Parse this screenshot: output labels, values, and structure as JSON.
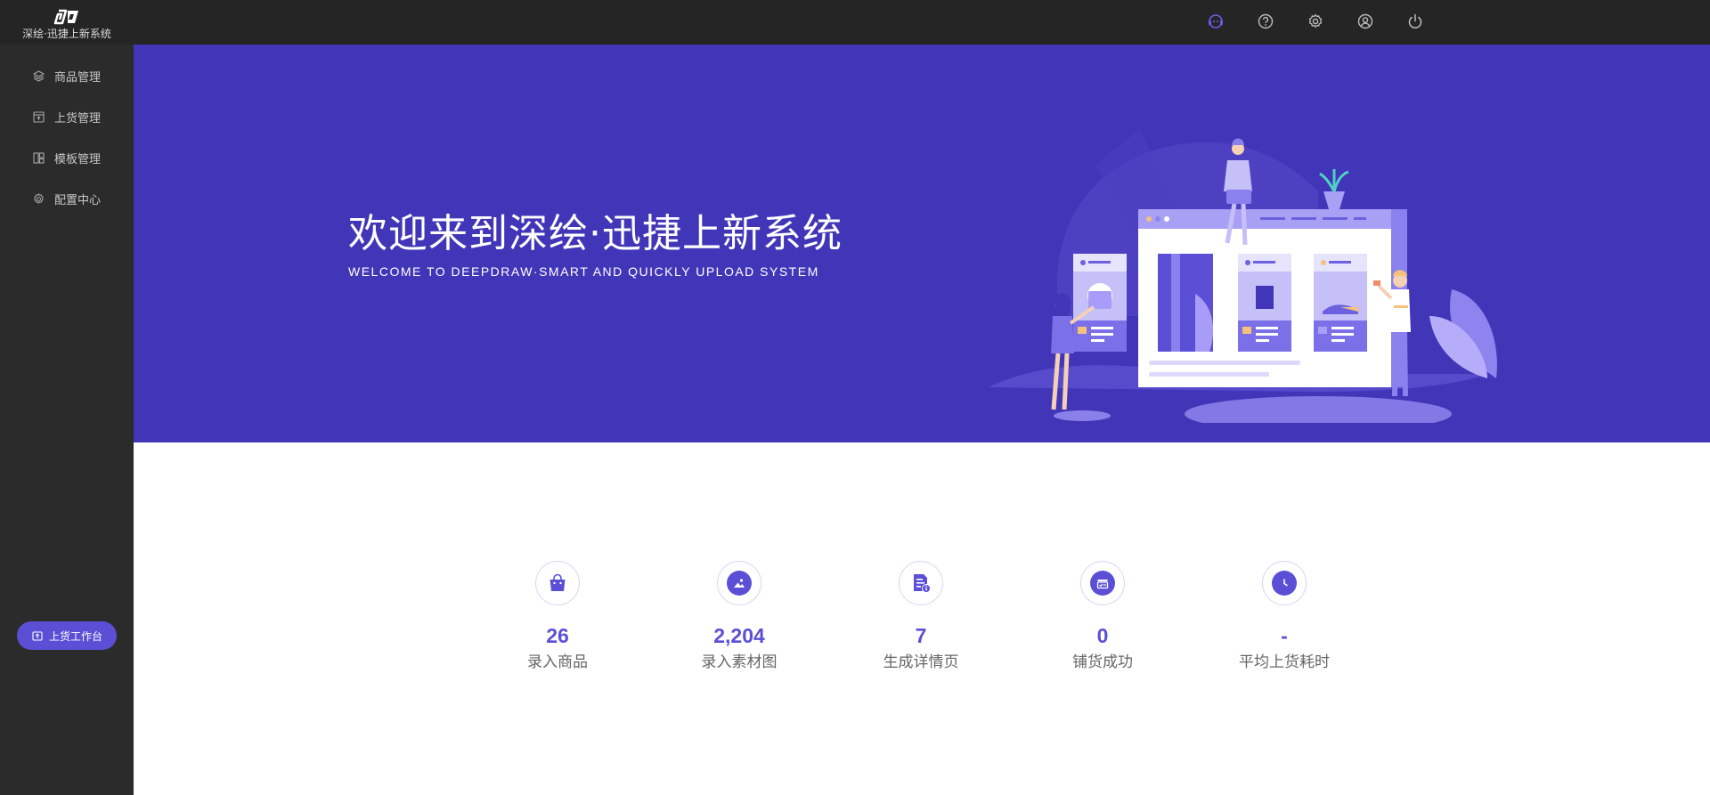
{
  "app": {
    "name": "深绘·迅捷上新系统"
  },
  "sidebar": {
    "items": [
      {
        "label": "商品管理",
        "icon": "layers-icon"
      },
      {
        "label": "上货管理",
        "icon": "upload-box-icon"
      },
      {
        "label": "模板管理",
        "icon": "template-icon"
      },
      {
        "label": "配置中心",
        "icon": "gear-config-icon"
      }
    ],
    "workbench_label": "上货工作台"
  },
  "topbar": {
    "icons": [
      "headset-icon",
      "help-icon",
      "settings-icon",
      "user-icon",
      "power-icon"
    ],
    "active_color": "#6a5cf0"
  },
  "banner": {
    "title": "欢迎来到深绘·迅捷上新系统",
    "subtitle": "WELCOME TO DEEPDRAW·SMART AND QUICKLY UPLOAD SYSTEM",
    "background": "#4236b8"
  },
  "stats": [
    {
      "value": "26",
      "label": "录入商品",
      "icon": "shopping-bag-icon"
    },
    {
      "value": "2,204",
      "label": "录入素材图",
      "icon": "image-icon"
    },
    {
      "value": "7",
      "label": "生成详情页",
      "icon": "detail-page-icon"
    },
    {
      "value": "0",
      "label": "铺货成功",
      "icon": "store-check-icon"
    },
    {
      "value": "-",
      "label": "平均上货耗时",
      "icon": "clock-icon"
    }
  ],
  "colors": {
    "accent": "#5b4fd6",
    "topbar": "#252525",
    "sidebar": "#2b2b2b"
  }
}
